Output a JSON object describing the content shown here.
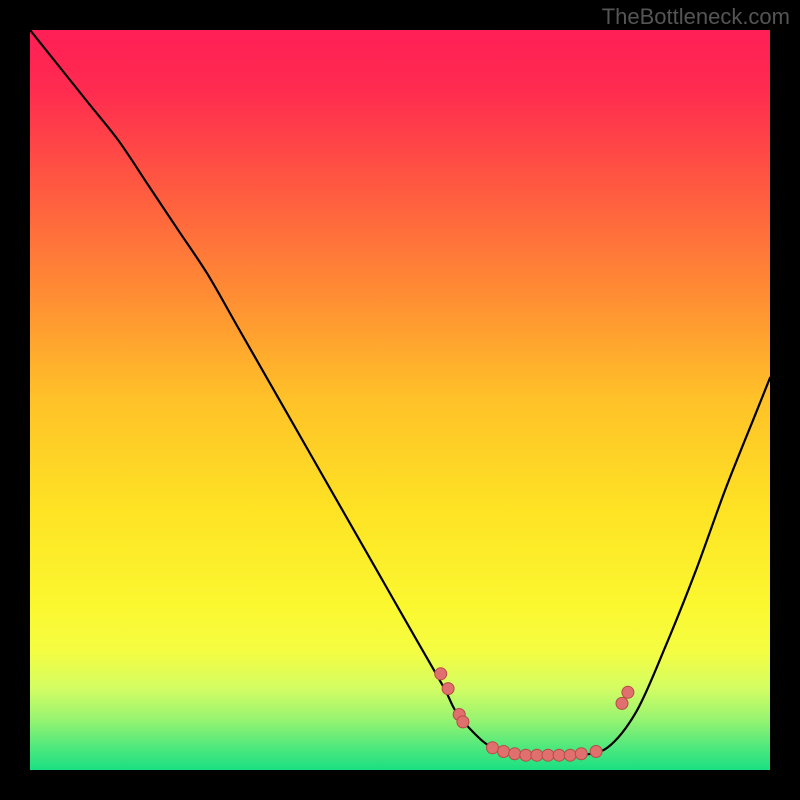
{
  "watermark": "TheBottleneck.com",
  "chart_data": {
    "type": "line",
    "title": "",
    "xlabel": "",
    "ylabel": "",
    "xlim": [
      0,
      100
    ],
    "ylim": [
      0,
      100
    ],
    "grid": false,
    "legend": false,
    "curve": {
      "x": [
        0,
        4,
        8,
        12,
        16,
        20,
        24,
        28,
        32,
        36,
        40,
        44,
        48,
        52,
        56,
        57.5,
        60,
        62.5,
        66,
        70,
        74,
        78,
        82,
        86,
        90,
        94,
        98,
        100
      ],
      "y": [
        100,
        95,
        90,
        85,
        79,
        73,
        67,
        60,
        53,
        46,
        39,
        32,
        25,
        18,
        11,
        8,
        5,
        3,
        2,
        2,
        2,
        3,
        8,
        17,
        27,
        38,
        48,
        53
      ]
    },
    "markers": {
      "x": [
        55.5,
        56.5,
        58.0,
        58.5,
        62.5,
        64.0,
        65.5,
        67.0,
        68.5,
        70.0,
        71.5,
        73.0,
        74.5,
        76.5,
        80.0,
        80.8
      ],
      "y": [
        13.0,
        11.0,
        7.5,
        6.5,
        3.0,
        2.5,
        2.2,
        2.0,
        2.0,
        2.0,
        2.0,
        2.0,
        2.2,
        2.5,
        9.0,
        10.5
      ]
    },
    "background_gradient": [
      {
        "stop": 0.0,
        "color": "#ff1f56"
      },
      {
        "stop": 0.08,
        "color": "#ff2b50"
      },
      {
        "stop": 0.2,
        "color": "#ff5542"
      },
      {
        "stop": 0.35,
        "color": "#ff8a34"
      },
      {
        "stop": 0.5,
        "color": "#ffc228"
      },
      {
        "stop": 0.65,
        "color": "#fee324"
      },
      {
        "stop": 0.78,
        "color": "#fbf830"
      },
      {
        "stop": 0.84,
        "color": "#f4fd42"
      },
      {
        "stop": 0.89,
        "color": "#d3fd63"
      },
      {
        "stop": 0.93,
        "color": "#9af470"
      },
      {
        "stop": 0.97,
        "color": "#4de87d"
      },
      {
        "stop": 1.0,
        "color": "#1adf83"
      }
    ],
    "marker_style": {
      "fill": "#e0706e",
      "stroke": "#b94a47",
      "r": 6
    },
    "line_style": {
      "stroke": "#000000",
      "width": 2.2
    }
  }
}
